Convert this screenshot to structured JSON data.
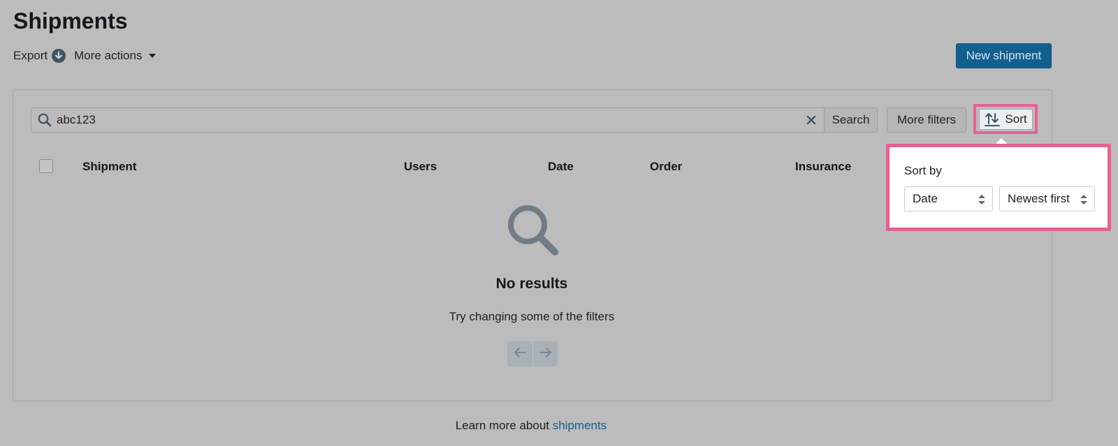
{
  "page": {
    "title": "Shipments"
  },
  "secondary_actions": {
    "export_label": "Export",
    "more_actions_label": "More actions"
  },
  "primary_action": {
    "label": "New shipment"
  },
  "filters": {
    "search_value": "abc123",
    "search_button": "Search",
    "more_filters_button": "More filters",
    "sort_button": "Sort"
  },
  "table": {
    "columns": [
      "Shipment",
      "Users",
      "Date",
      "Order",
      "Insurance"
    ]
  },
  "empty_state": {
    "title": "No results",
    "subtitle": "Try changing some of the filters"
  },
  "sort_popover": {
    "label": "Sort by",
    "sort_field": "Date",
    "sort_order": "Newest first"
  },
  "footer": {
    "prefix": "Learn more about ",
    "link_text": "shipments"
  },
  "colors": {
    "accent": "#12608f",
    "highlight": "#ec5f93",
    "overlay_background": "#bcbcbc"
  },
  "icons": {
    "export": "download-circle-icon",
    "more_actions": "caret-down-icon",
    "search": "search-icon",
    "clear": "close-icon",
    "sort": "sort-icon",
    "empty": "search-icon",
    "pager_prev": "arrow-left-icon",
    "pager_next": "arrow-right-icon"
  }
}
